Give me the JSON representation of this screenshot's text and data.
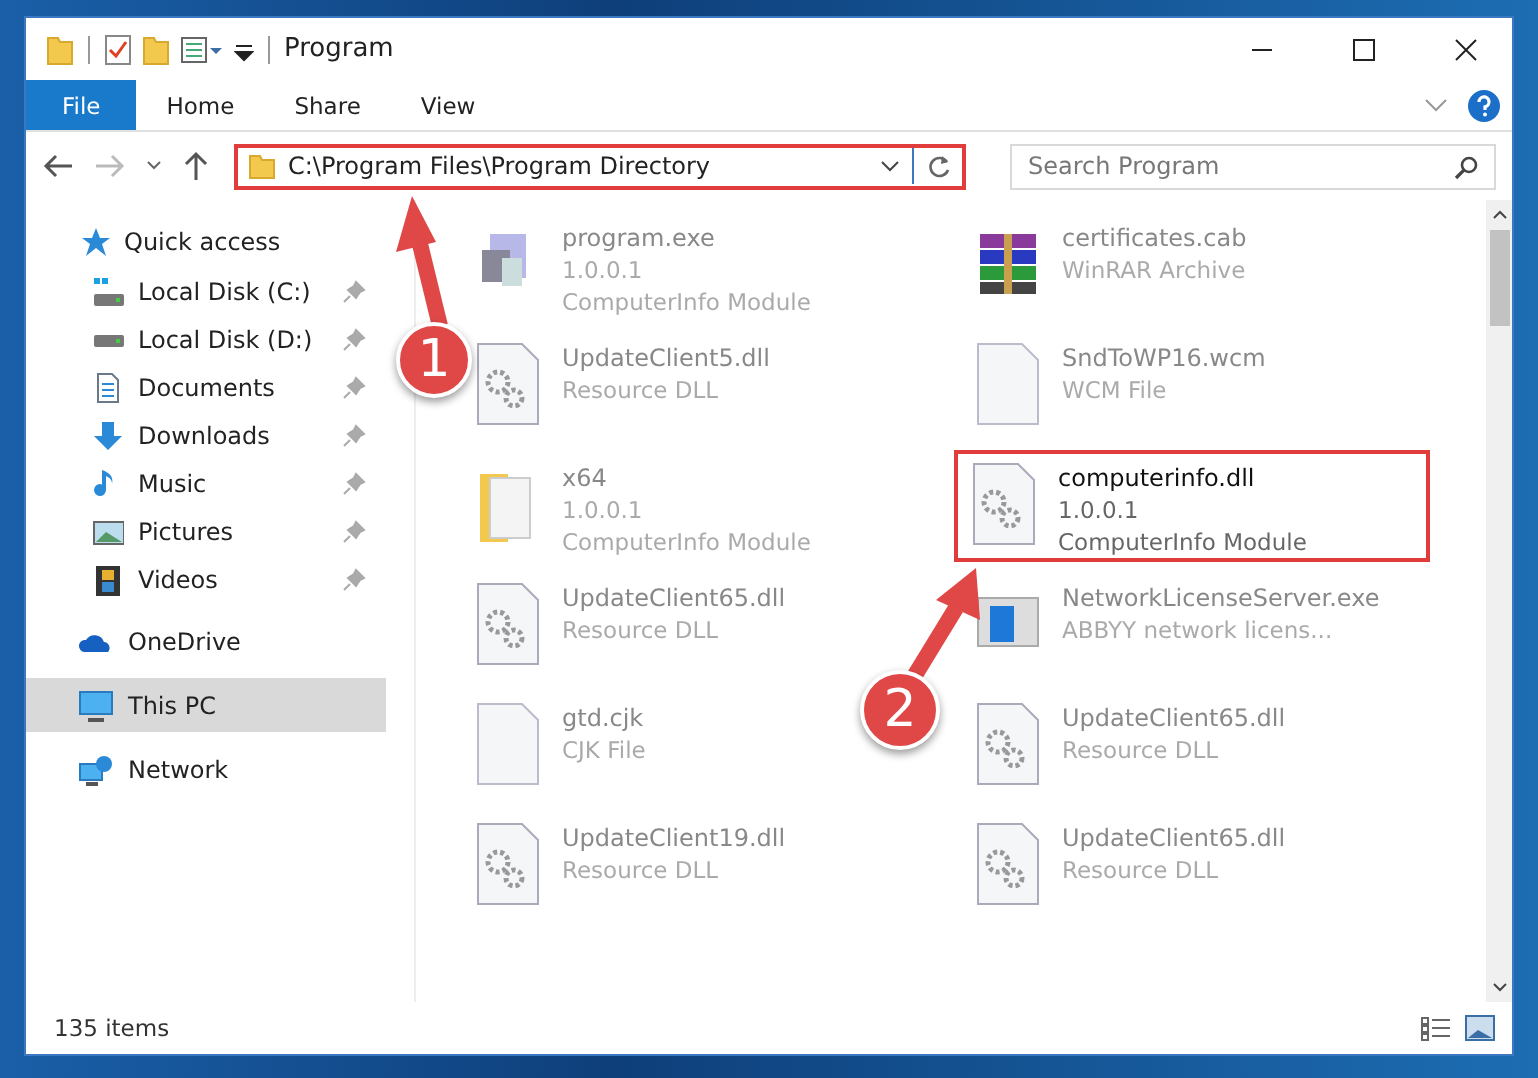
{
  "window": {
    "title": "Program"
  },
  "ribbon": {
    "tabs": [
      {
        "label": "File",
        "selected": true
      },
      {
        "label": "Home",
        "selected": false
      },
      {
        "label": "Share",
        "selected": false
      },
      {
        "label": "View",
        "selected": false
      }
    ]
  },
  "address_bar": {
    "path": "C:\\Program Files\\Program Directory",
    "highlighted": true
  },
  "search": {
    "placeholder": "Search Program"
  },
  "sidebar": {
    "items": [
      {
        "label": "Quick access",
        "kind": "star",
        "selected": false,
        "children": [
          {
            "label": "Local Disk (C:)",
            "kind": "drive-c",
            "pinned": true,
            "selected": false
          },
          {
            "label": "Local Disk (D:)",
            "kind": "drive",
            "pinned": true,
            "selected": false
          },
          {
            "label": "Documents",
            "kind": "documents",
            "pinned": true,
            "selected": false
          },
          {
            "label": "Downloads",
            "kind": "downloads",
            "pinned": true,
            "selected": false
          },
          {
            "label": "Music",
            "kind": "music",
            "pinned": true,
            "selected": false
          },
          {
            "label": "Pictures",
            "kind": "pictures",
            "pinned": true,
            "selected": false
          },
          {
            "label": "Videos",
            "kind": "videos",
            "pinned": true,
            "selected": false
          }
        ]
      },
      {
        "label": "OneDrive",
        "kind": "cloud",
        "selected": false
      },
      {
        "label": "This PC",
        "kind": "pc",
        "selected": true
      },
      {
        "label": "Network",
        "kind": "network",
        "selected": false
      }
    ]
  },
  "files": [
    {
      "kind": "exe",
      "name": "program.exe",
      "details": [
        "1.0.0.1",
        "ComputerInfo Module"
      ],
      "highlighted": false
    },
    {
      "kind": "archive",
      "name": "certificates.cab",
      "details": [
        "WinRAR Archive"
      ],
      "highlighted": false
    },
    {
      "kind": "dll",
      "name": "UpdateClient5.dll",
      "details": [
        "Resource DLL"
      ],
      "highlighted": false
    },
    {
      "kind": "blank",
      "name": "SndToWP16.wcm",
      "details": [
        "WCM File"
      ],
      "highlighted": false
    },
    {
      "kind": "folder",
      "name": "x64",
      "details": [
        "1.0.0.1",
        "ComputerInfo Module"
      ],
      "highlighted": false
    },
    {
      "kind": "dll",
      "name": "computerinfo.dll",
      "details": [
        "1.0.0.1",
        "ComputerInfo Module"
      ],
      "highlighted": true
    },
    {
      "kind": "dll",
      "name": "UpdateClient65.dll",
      "details": [
        "Resource DLL"
      ],
      "highlighted": false
    },
    {
      "kind": "app",
      "name": "NetworkLicenseServer.exe",
      "details": [
        "ABBYY network licens..."
      ],
      "highlighted": false
    },
    {
      "kind": "blank",
      "name": "gtd.cjk",
      "details": [
        "CJK File"
      ],
      "highlighted": false
    },
    {
      "kind": "dll",
      "name": "UpdateClient65.dll",
      "details": [
        "Resource DLL"
      ],
      "highlighted": false
    },
    {
      "kind": "dll",
      "name": "UpdateClient19.dll",
      "details": [
        "Resource DLL"
      ],
      "highlighted": false
    },
    {
      "kind": "dll",
      "name": "UpdateClient65.dll",
      "details": [
        "Resource DLL"
      ],
      "highlighted": false
    }
  ],
  "status_bar": {
    "item_count": "135 items"
  },
  "callouts": [
    {
      "number": "1"
    },
    {
      "number": "2"
    }
  ]
}
